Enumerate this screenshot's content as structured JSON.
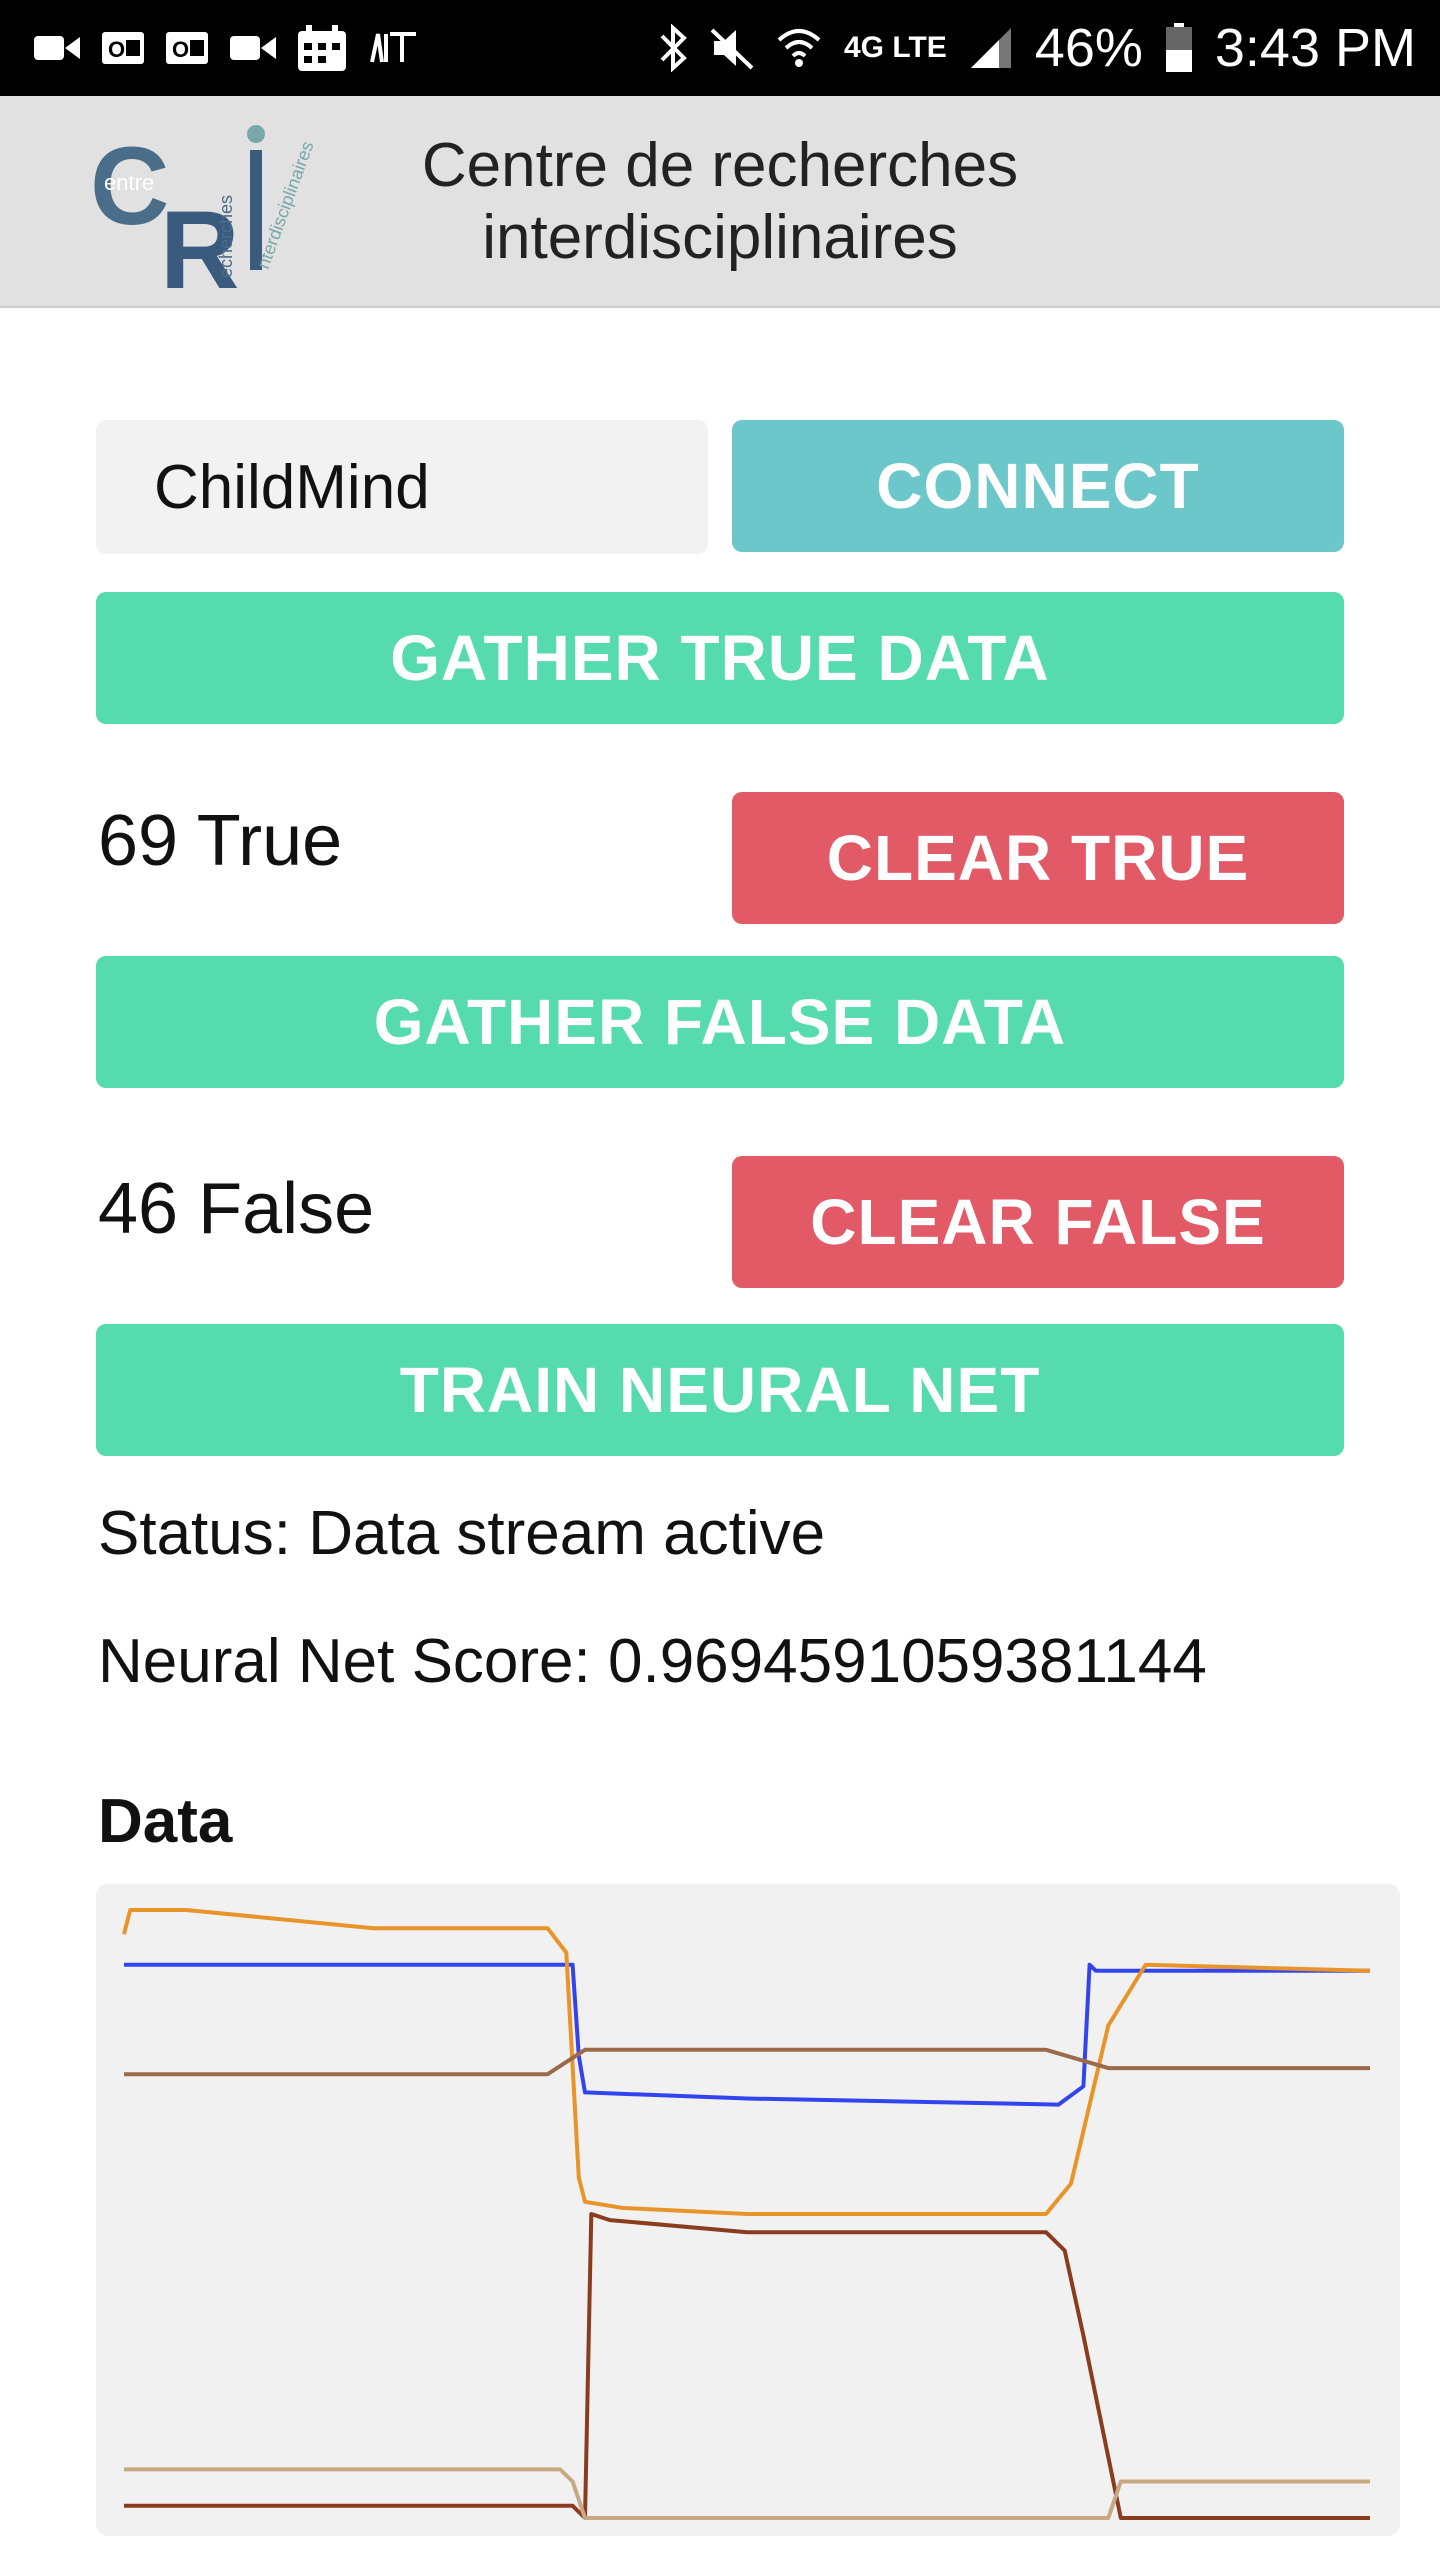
{
  "status_bar": {
    "battery": "46%",
    "time": "3:43 PM",
    "network": "4G LTE",
    "icons": [
      "video-icon",
      "outlook-icon",
      "outlook-icon",
      "video-icon",
      "calendar-icon",
      "app-icon",
      "bluetooth-icon",
      "mute-icon",
      "wifi-icon",
      "signal-icon",
      "battery-icon"
    ]
  },
  "header": {
    "logo_text": "CRI",
    "logo_sub": [
      "entre",
      "echerches",
      "nterdisciplinaires"
    ],
    "title_line1": "Centre de recherches",
    "title_line2": "interdisciplinaires"
  },
  "controls": {
    "device_name": "ChildMind",
    "connect_label": "CONNECT",
    "gather_true_label": "GATHER TRUE DATA",
    "true_count": "69 True",
    "clear_true_label": "CLEAR TRUE",
    "gather_false_label": "GATHER FALSE DATA",
    "false_count": "46 False",
    "clear_false_label": "CLEAR FALSE",
    "train_label": "TRAIN NEURAL NET"
  },
  "status": {
    "status_text": "Status: Data stream active",
    "score_text": "Neural Net Score: 0.9694591059381144"
  },
  "colors": {
    "green": "#55dbad",
    "teal": "#6cc7ca",
    "red": "#e15a65",
    "series_blue": "#3344ee",
    "series_orange": "#e8942a",
    "series_brown": "#9a6a4a",
    "series_darkbrown": "#8a3d1e",
    "series_tan": "#c8a882"
  },
  "chart_title": "Data",
  "chart_data": {
    "type": "line",
    "title": "Data",
    "xlabel": "",
    "ylabel": "",
    "xlim": [
      0,
      100
    ],
    "ylim": [
      0,
      100
    ],
    "grid": false,
    "series": [
      {
        "x": [
          0,
          36,
          36.5,
          37,
          50,
          75,
          77,
          77.5,
          78,
          100
        ],
        "values": [
          91,
          91,
          76,
          70,
          69,
          68,
          71,
          91,
          90,
          90
        ]
      },
      {
        "x": [
          0,
          0.5,
          5,
          20,
          34,
          35.5,
          36.5,
          37,
          40,
          50,
          74,
          76,
          79,
          82,
          100
        ],
        "values": [
          96,
          100,
          100,
          97,
          97,
          93,
          56,
          52,
          51,
          50,
          50,
          55,
          81,
          91,
          90
        ]
      },
      {
        "x": [
          0,
          34,
          37,
          50,
          74,
          79,
          100
        ],
        "values": [
          73,
          73,
          77,
          77,
          77,
          74,
          74
        ]
      },
      {
        "x": [
          0,
          36,
          37,
          37.5,
          39,
          50,
          74,
          75.5,
          77,
          79,
          80,
          100
        ],
        "values": [
          2,
          2,
          0,
          50,
          49,
          47,
          47,
          44,
          30,
          10,
          0,
          0
        ]
      },
      {
        "x": [
          0,
          35,
          36,
          37,
          50,
          79,
          80,
          100
        ],
        "values": [
          8,
          8,
          6,
          0,
          0,
          0,
          6,
          6
        ]
      }
    ]
  }
}
